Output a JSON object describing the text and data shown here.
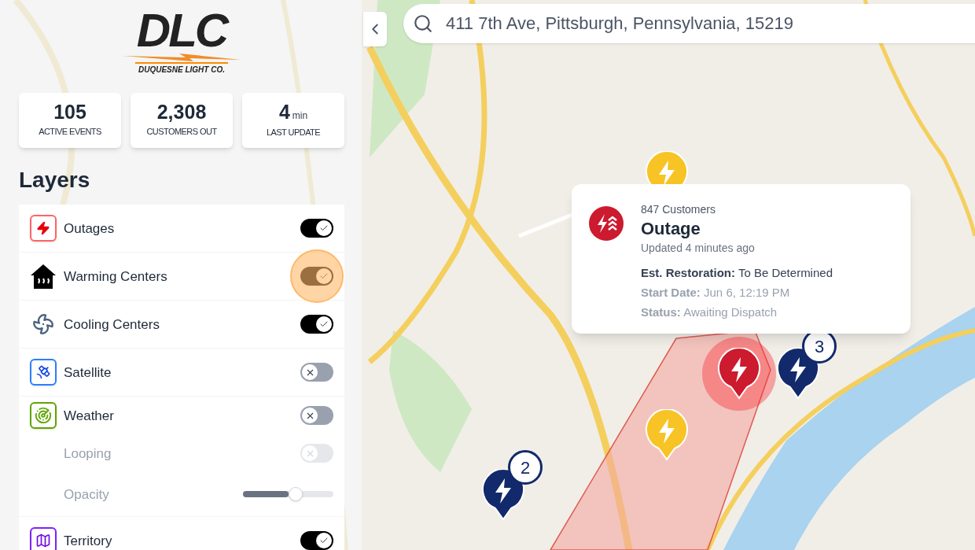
{
  "logo": {
    "mark": "DLC",
    "tagline": "DUQUESNE LIGHT CO."
  },
  "stats": [
    {
      "value": "105",
      "label": "ACTIVE EVENTS"
    },
    {
      "value": "2,308",
      "label": "CUSTOMERS OUT"
    },
    {
      "value": "4",
      "unit": "min",
      "label": "LAST UPDATE"
    }
  ],
  "layers": {
    "title": "Layers",
    "items": [
      {
        "kind": "toggle",
        "label": "Outages",
        "on": true,
        "highlighted": false
      },
      {
        "kind": "toggle",
        "label": "Warming Centers",
        "on": true,
        "highlighted": true
      },
      {
        "kind": "toggle",
        "label": "Cooling Centers",
        "on": true,
        "highlighted": false
      },
      {
        "kind": "toggle",
        "label": "Satellite",
        "on": false,
        "highlighted": false
      },
      {
        "kind": "toggle",
        "label": "Weather",
        "on": false,
        "highlighted": false,
        "children": [
          {
            "kind": "toggle",
            "label": "Looping",
            "on": false,
            "disabled": true
          },
          {
            "kind": "slider",
            "label": "Opacity",
            "level": 0.5
          }
        ]
      },
      {
        "kind": "toggle",
        "label": "Territory",
        "on": true,
        "highlighted": false
      }
    ]
  },
  "search": {
    "value": "411 7th Ave, Pittsburgh, Pennsylvania, 15219"
  },
  "popup": {
    "customers": "847 Customers",
    "title": "Outage",
    "updated": "Updated 4 minutes ago",
    "details": [
      {
        "label": "Est. Restoration:",
        "value": "To Be Determined",
        "emphasis": true
      },
      {
        "label": "Start Date:",
        "value": "Jun 6, 12:19 PM",
        "emphasis": false
      },
      {
        "label": "Status:",
        "value": "Awaiting Dispatch",
        "emphasis": false
      }
    ]
  },
  "markers": [
    {
      "kind": "warning"
    },
    {
      "kind": "warning"
    },
    {
      "kind": "outage"
    },
    {
      "kind": "cluster",
      "count": "2"
    },
    {
      "kind": "cluster",
      "count": "3"
    }
  ]
}
